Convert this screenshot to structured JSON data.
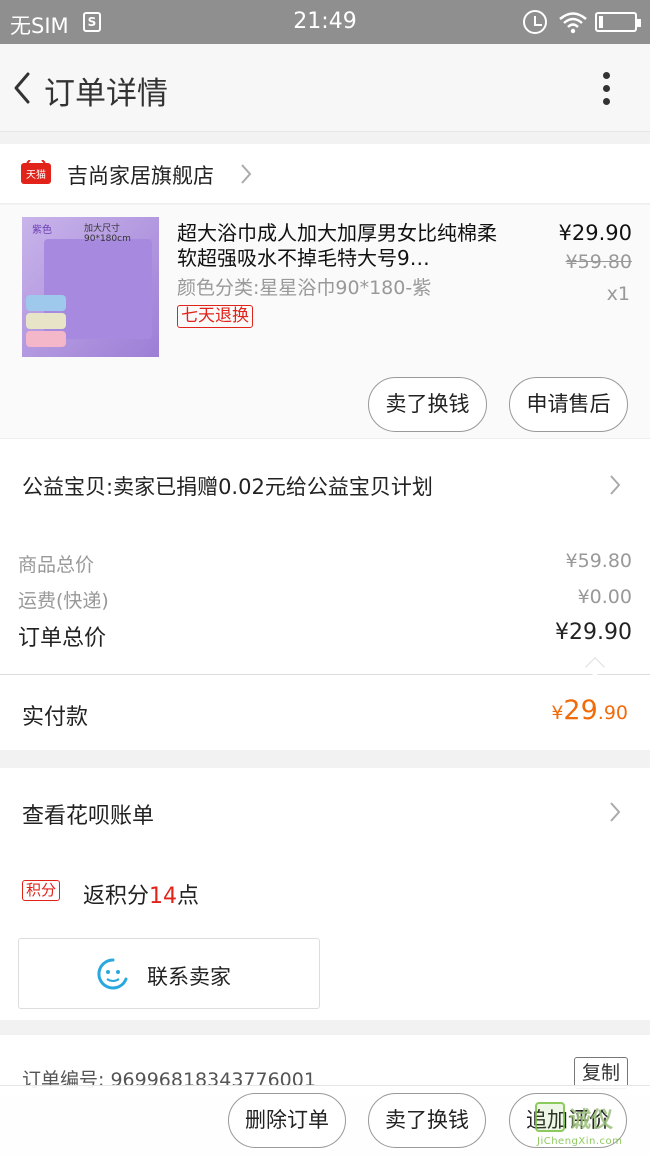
{
  "status_bar": {
    "carrier": "无SIM",
    "sim_icon_glyph": "S",
    "time": "21:49"
  },
  "nav": {
    "title": "订单详情"
  },
  "shop": {
    "badge": "天猫",
    "name": "吉尚家居旗舰店"
  },
  "item": {
    "thumb_tag": "紫色",
    "thumb_size_text": "加大尺寸 90*180cm",
    "title": "超大浴巾成人加大加厚男女比纯棉柔软超强吸水不掉毛特大号9…",
    "sku": "颜色分类:星星浴巾90*180-紫",
    "return_badge": "七天退换",
    "price": "¥29.90",
    "original_price": "¥59.80",
    "quantity": "x1",
    "sell_button": "卖了换钱",
    "after_sale_button": "申请售后"
  },
  "charity": {
    "text": "公益宝贝:卖家已捐赠0.02元给公益宝贝计划"
  },
  "summary": {
    "goods_total_label": "商品总价",
    "goods_total_value": "¥59.80",
    "shipping_label": "运费(快递)",
    "shipping_value": "¥0.00",
    "order_total_label": "订单总价",
    "order_total_value": "¥29.90"
  },
  "paid": {
    "label": "实付款",
    "currency": "¥",
    "amount_int": "29",
    "amount_dec": ".90"
  },
  "huabei": {
    "label": "查看花呗账单"
  },
  "points": {
    "badge": "积分",
    "prefix": "返积分",
    "count": "14",
    "suffix": "点"
  },
  "contact": {
    "label": "联系卖家"
  },
  "order_info": {
    "order_number": "订单编号: 96996818343776001",
    "copy_button": "复制"
  },
  "bottom_bar": {
    "delete": "删除订单",
    "sell": "卖了换钱",
    "review": "追加评价"
  },
  "watermark": {
    "text": "诚仪",
    "site": "JiChengXin.com"
  },
  "colors": {
    "price_orange": "#f26b0b",
    "tmall_red": "#e2231a",
    "status_bar": "#8f8f8f"
  }
}
